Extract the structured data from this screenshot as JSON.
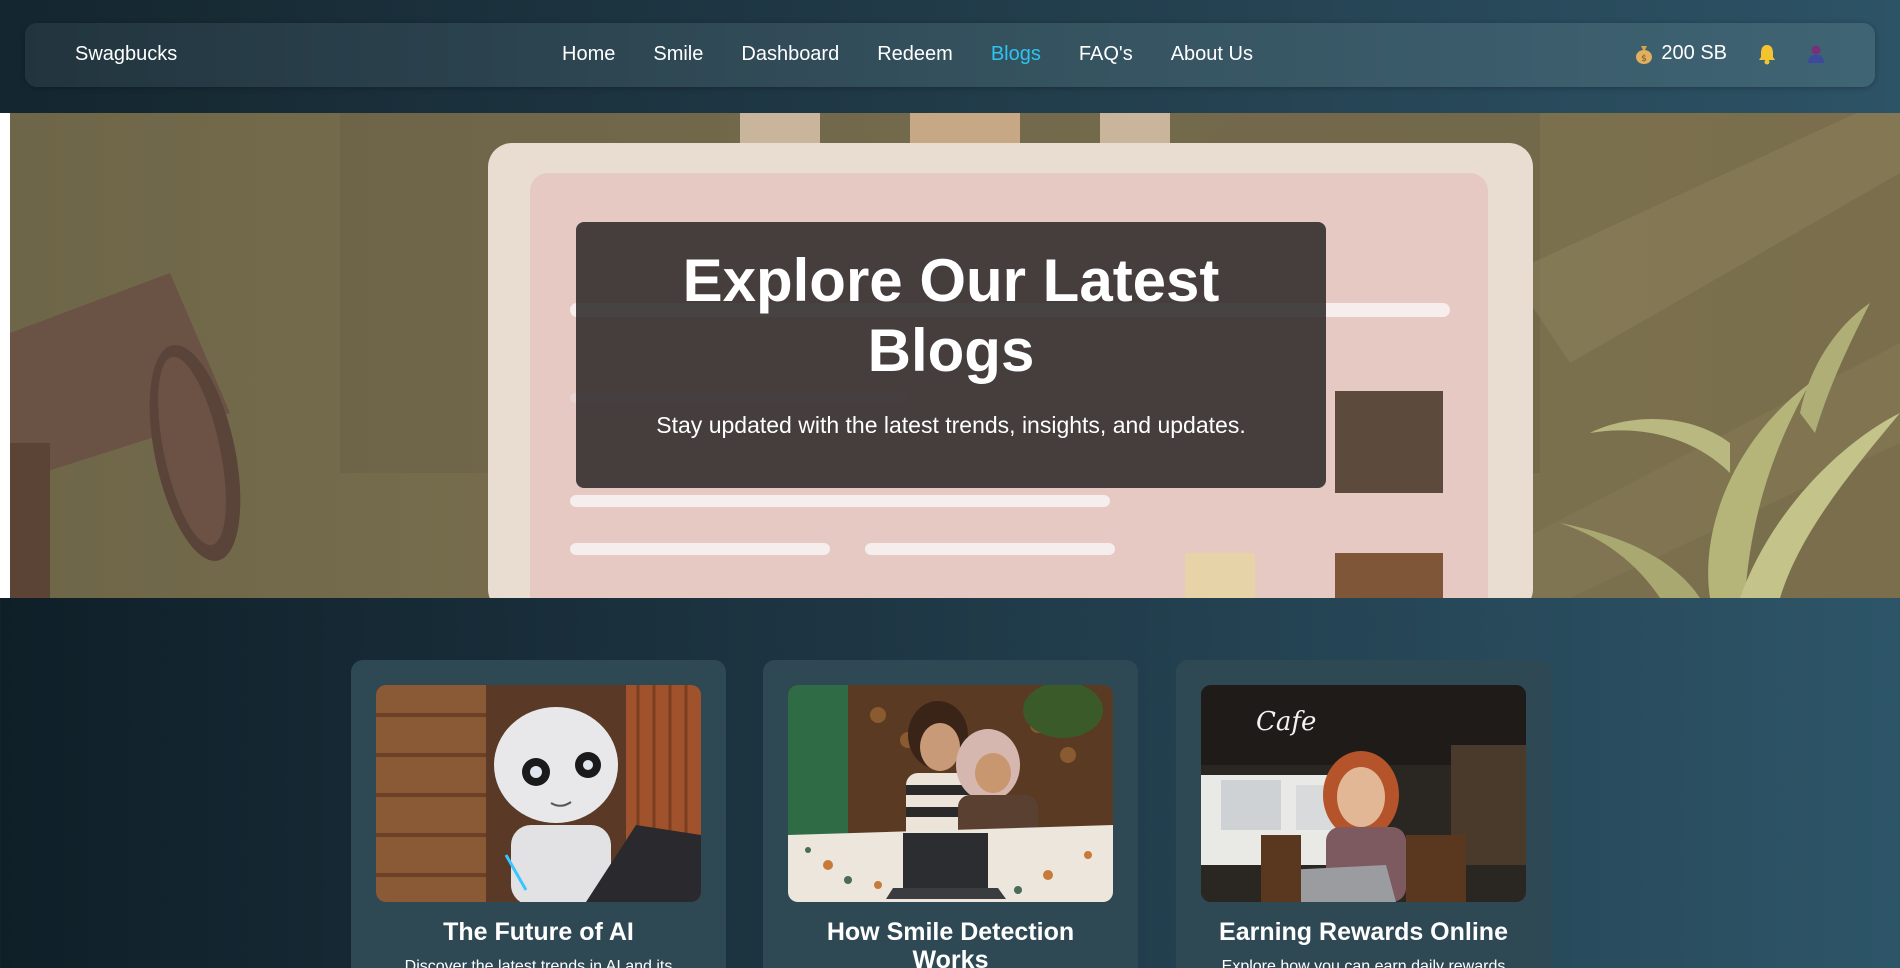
{
  "nav": {
    "brand": "Swagbucks",
    "links": [
      "Home",
      "Smile",
      "Dashboard",
      "Redeem",
      "Blogs",
      "FAQ's",
      "About Us"
    ],
    "active": "Blogs",
    "balance": "200 SB",
    "icons": [
      "money-bag-icon",
      "bell-icon",
      "user-icon"
    ]
  },
  "hero": {
    "title": "Explore Our Latest Blogs",
    "subtitle": "Stay updated with the latest trends, insights, and updates."
  },
  "cards": [
    {
      "title": "The Future of AI",
      "text": "Discover the latest trends in AI and its"
    },
    {
      "title": "How Smile Detection Works",
      "text": ""
    },
    {
      "title": "Earning Rewards Online",
      "text": "Explore how you can earn daily rewards"
    }
  ],
  "colors": {
    "active_link": "#2ec4f0",
    "card_bg": "#2e4854",
    "overlay_bg": "#2a2626"
  }
}
